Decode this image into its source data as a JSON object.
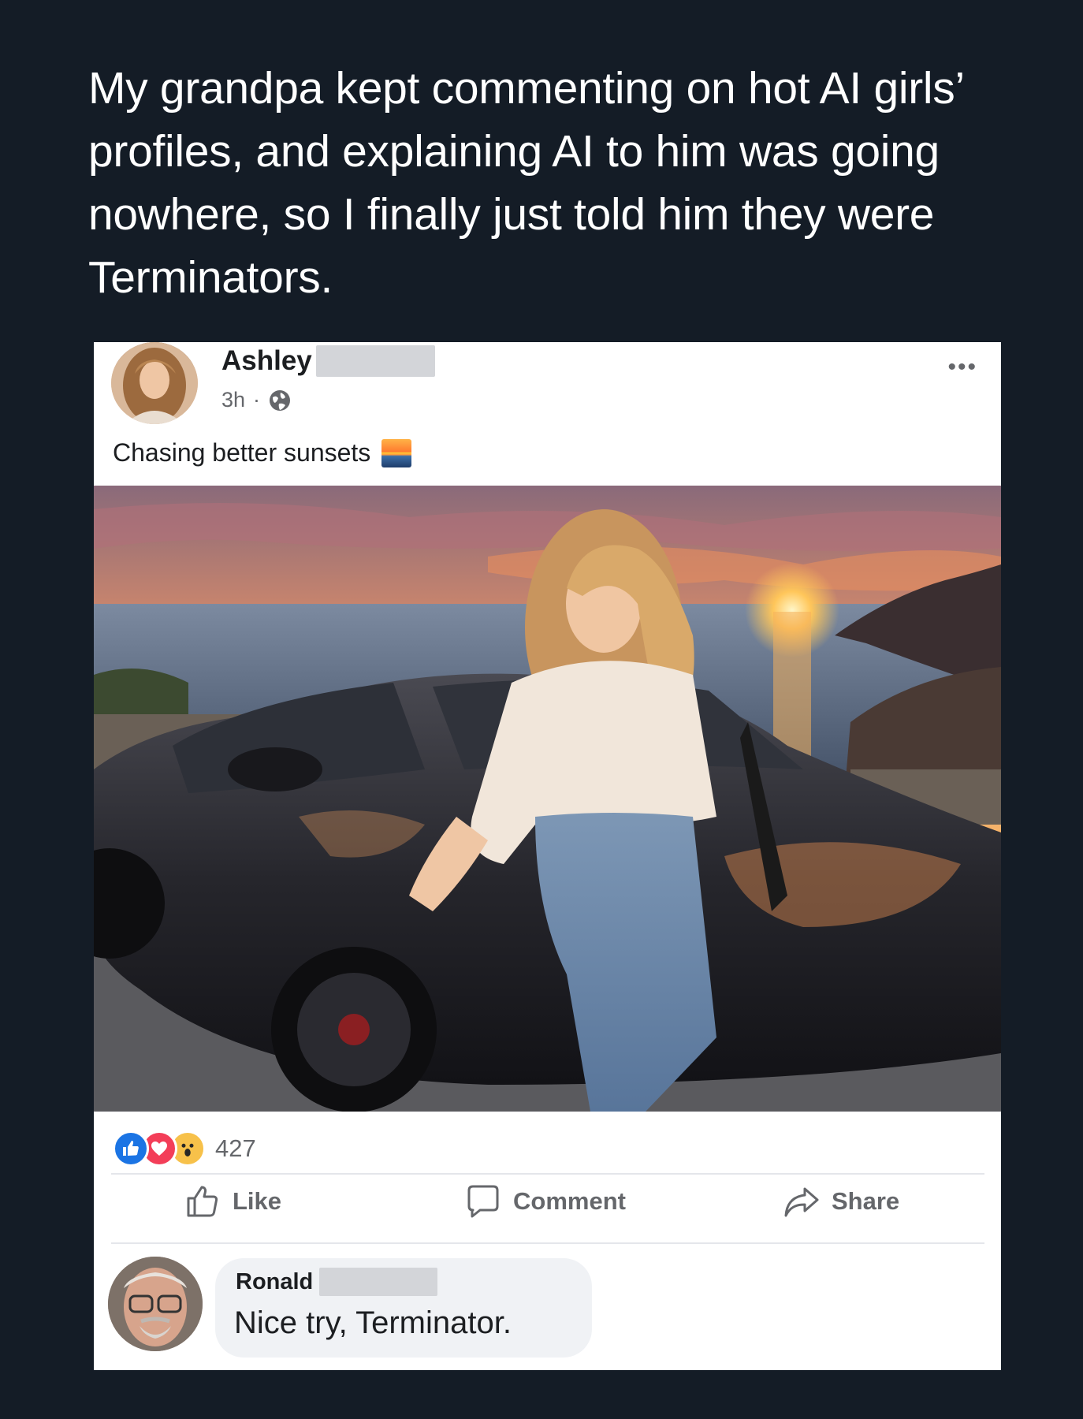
{
  "caption": "My grandpa kept commenting on hot AI girls’ profiles, and explaining AI to him was going nowhere, so I finally just told him they were Terminators.",
  "post": {
    "author": "Ashley",
    "time": "3h",
    "separator": "·",
    "text": "Chasing better sunsets",
    "more_icon": "more-options-icon",
    "reaction_count": "427",
    "reactions": [
      "like-icon",
      "love-icon",
      "wow-icon"
    ]
  },
  "actions": {
    "like": "Like",
    "comment": "Comment",
    "share": "Share"
  },
  "comment": {
    "author": "Ronald",
    "text": "Nice try, Terminator."
  },
  "colors": {
    "background": "#141c26",
    "card": "#ffffff",
    "like_blue": "#1b74e4",
    "love_red": "#f33e58",
    "wow_yellow": "#f7c14a",
    "secondary_text": "#65676b"
  }
}
